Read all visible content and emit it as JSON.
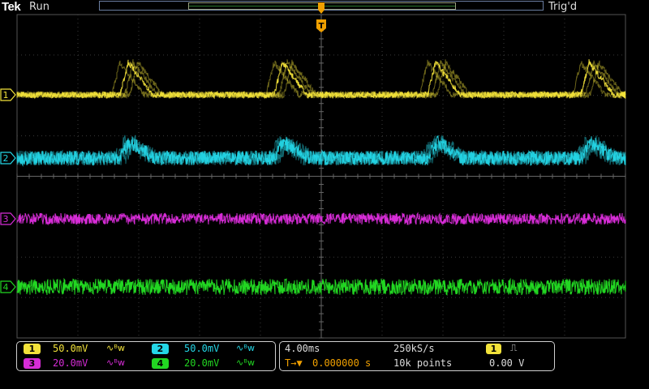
{
  "header": {
    "brand": "Tek",
    "run_state": "Run",
    "trigger_state": "Trig'd",
    "trigger_position_label": "T"
  },
  "channels": [
    {
      "id": "1",
      "color": "#f2e23a",
      "scale": "50.0mV",
      "bandwidth_icon": "bandwidth-limit-icon",
      "bw_label": "∿ᴮw"
    },
    {
      "id": "2",
      "color": "#24d6e6",
      "scale": "50.0mV",
      "bandwidth_icon": "bandwidth-limit-icon",
      "bw_label": "∿ᴮw"
    },
    {
      "id": "3",
      "color": "#d62cd6",
      "scale": "20.0mV",
      "bandwidth_icon": "bandwidth-limit-icon",
      "bw_label": "∿ᴮw"
    },
    {
      "id": "4",
      "color": "#22d622",
      "scale": "20.0mV",
      "bandwidth_icon": "bandwidth-limit-icon",
      "bw_label": "∿ᴮw"
    }
  ],
  "timebase": {
    "scale": "4.00ms",
    "sample_rate": "250kS/s",
    "record_length": "10k points",
    "trigger_delay_icon": "trigger-delay-icon",
    "trigger_delay_label": "T→▼",
    "delay": "0.000000 s"
  },
  "trigger": {
    "source": "1",
    "slope_icon": "rising-edge-icon",
    "slope_label": "⎍",
    "level": "0.00 V"
  },
  "colors": {
    "graticule": "#555555",
    "panel_border": "#cfcfcf",
    "trigger_marker": "#f0a000",
    "background": "#000000"
  }
}
